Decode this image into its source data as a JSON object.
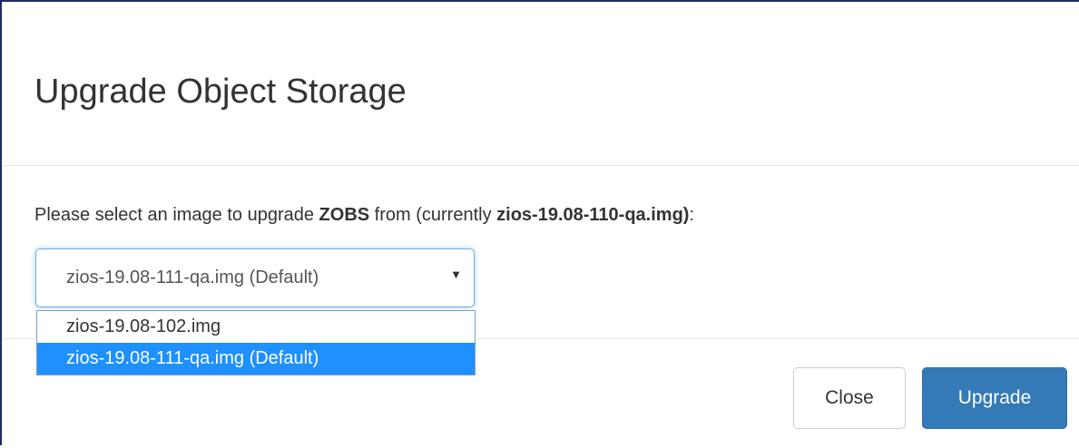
{
  "modal": {
    "title": "Upgrade Object Storage",
    "prompt": {
      "prefix": "Please select an image to upgrade ",
      "product": "ZOBS",
      "middle": " from (currently ",
      "current_image": "zios-19.08-110-qa.img)",
      "suffix": ":"
    },
    "image_select": {
      "value": "zios-19.08-111-qa.img (Default)",
      "options": [
        "zios-19.08-102.img",
        "zios-19.08-111-qa.img (Default)"
      ],
      "selected_index": 1
    },
    "footer": {
      "close_label": "Close",
      "upgrade_label": "Upgrade"
    }
  },
  "colors": {
    "primary": "#337ab7",
    "option_highlight": "#1e90ff",
    "focus_border": "#66afe9"
  }
}
